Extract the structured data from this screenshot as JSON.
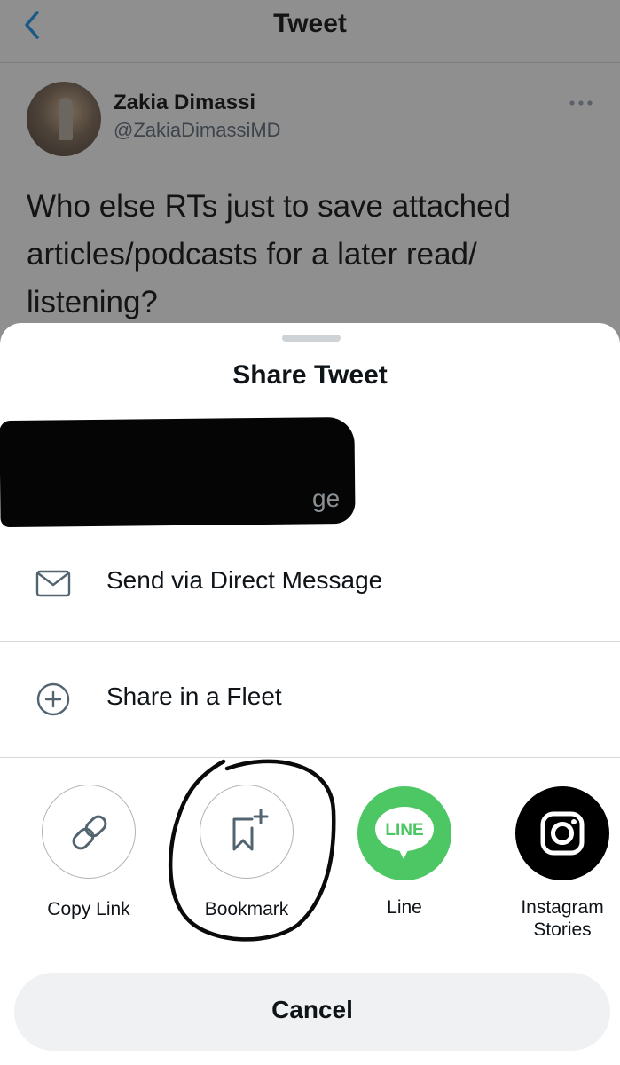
{
  "header": {
    "title": "Tweet",
    "back_icon": "chevron-left-icon"
  },
  "tweet": {
    "author_name": "Zakia Dimassi",
    "author_handle": "@ZakiaDimassiMD",
    "text": "Who else RTs just to save attached articles/podcasts for a later read/ listening?"
  },
  "share_sheet": {
    "title": "Share Tweet",
    "redacted_peek": "ge",
    "rows": [
      {
        "label": "Send via Direct Message",
        "icon": "mail-icon"
      },
      {
        "label": "Share in a Fleet",
        "icon": "plus-circle-icon"
      }
    ],
    "targets": [
      {
        "label": "Copy Link",
        "icon": "link-icon"
      },
      {
        "label": "Bookmark",
        "icon": "bookmark-add-icon"
      },
      {
        "label": "Line",
        "icon": "line-app-icon",
        "logo_text": "LINE",
        "color": "#4cc764"
      },
      {
        "label": "Instagram Stories",
        "label_line1": "Instagram",
        "label_line2": "Stories",
        "icon": "instagram-icon",
        "color": "#000000"
      }
    ],
    "cancel_label": "Cancel"
  },
  "colors": {
    "backdrop": "#8f8f8f",
    "accent": "#1d9bf0",
    "line_green": "#4cc764"
  }
}
